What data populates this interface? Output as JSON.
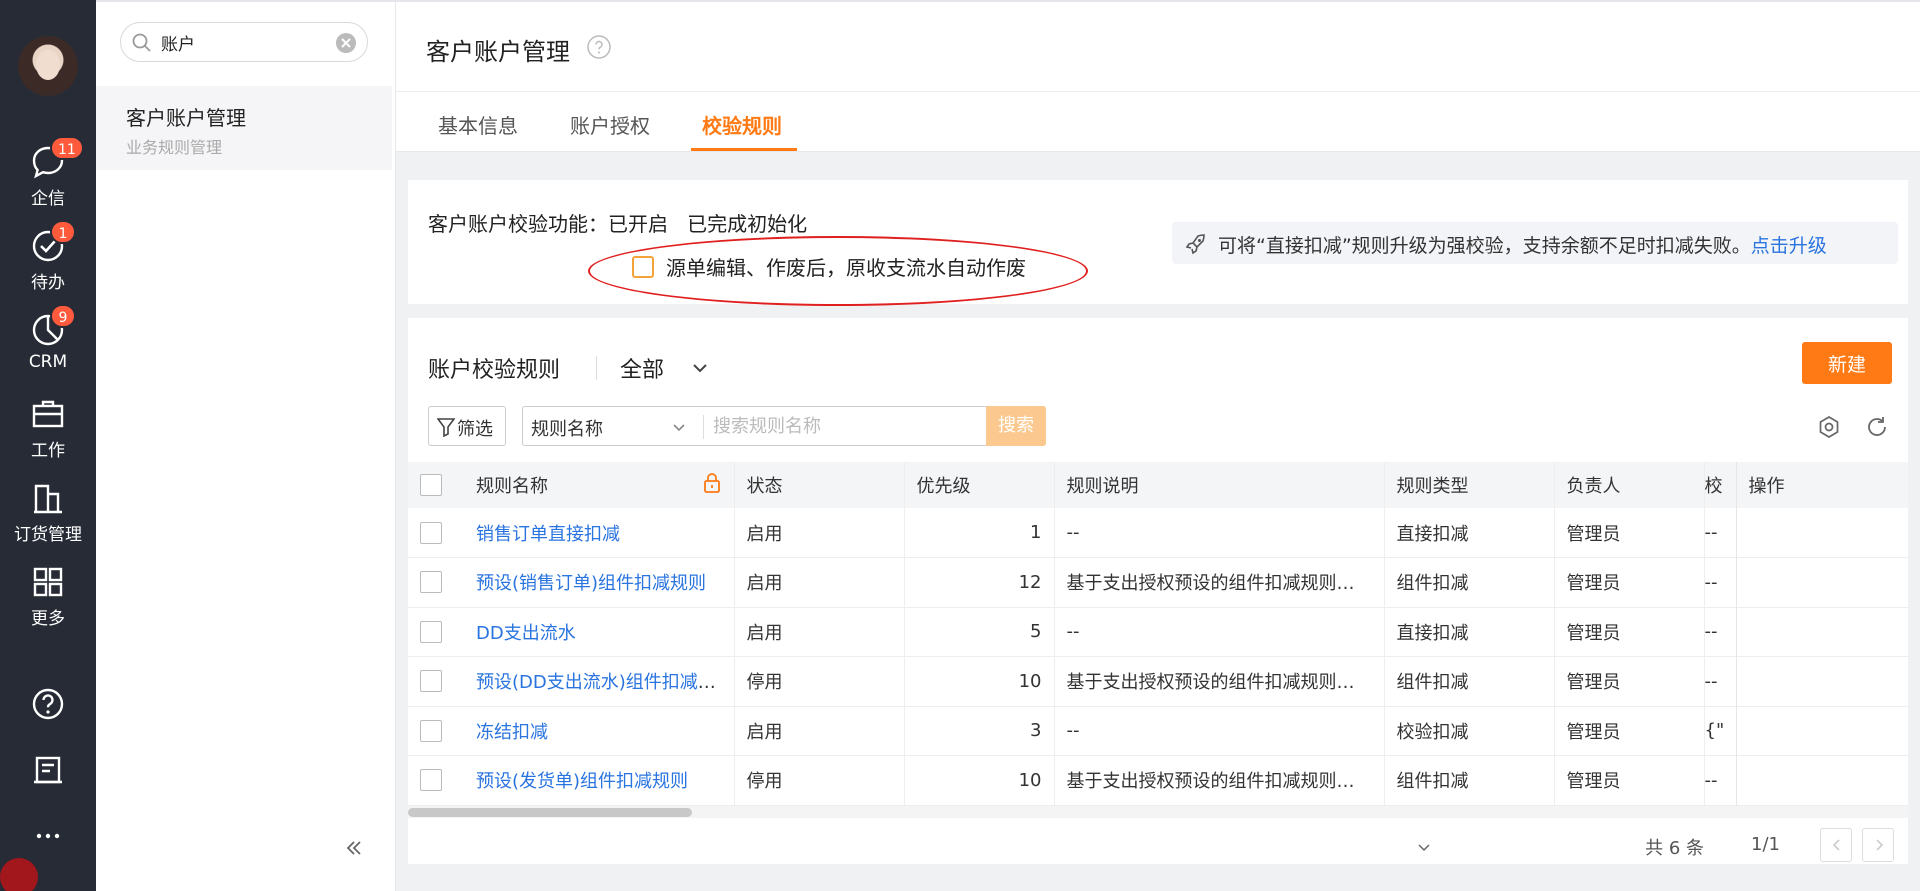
{
  "nav": {
    "items": [
      {
        "label": "企信",
        "badge": "11",
        "icon": "chat-bubble-icon"
      },
      {
        "label": "待办",
        "badge": "1",
        "icon": "check-circle-icon"
      },
      {
        "label": "CRM",
        "badge": "9",
        "icon": "pie-chart-icon"
      },
      {
        "label": "工作",
        "badge": "",
        "icon": "briefcase-icon"
      },
      {
        "label": "订货管理",
        "badge": "",
        "icon": "building-icon"
      },
      {
        "label": "更多",
        "badge": "",
        "icon": "grid-icon"
      }
    ],
    "bottom_icons": [
      "help-circle-icon",
      "notebook-icon",
      "more-dots-icon"
    ]
  },
  "sidebar": {
    "search_value": "账户",
    "item_title": "客户账户管理",
    "item_subtitle": "业务规则管理"
  },
  "header": {
    "title": "客户账户管理"
  },
  "tabs": [
    {
      "label": "基本信息",
      "active": false
    },
    {
      "label": "账户授权",
      "active": false
    },
    {
      "label": "校验规则",
      "active": true
    }
  ],
  "status": {
    "text": "客户账户校验功能：已开启   已完成初始化",
    "checkbox_label": "源单编辑、作废后，原收支流水自动作废",
    "tip_text": "可将“直接扣减”规则升级为强校验，支持余额不足时扣减失败。",
    "tip_link": "点击升级"
  },
  "rules": {
    "title": "账户校验规则",
    "scope": "全部",
    "new_button": "新建",
    "filter_button": "筛选",
    "field_select": "规则名称",
    "search_placeholder": "搜索规则名称",
    "search_button": "搜索",
    "columns": [
      "规则名称",
      "状态",
      "优先级",
      "规则说明",
      "规则类型",
      "负责人",
      "校",
      "操作"
    ],
    "rows": [
      {
        "name": "销售订单直接扣减",
        "status": "启用",
        "priority": "1",
        "desc": "--",
        "type": "直接扣减",
        "owner": "管理员",
        "extra": "--"
      },
      {
        "name": "预设(销售订单)组件扣减规则",
        "status": "启用",
        "priority": "12",
        "desc": "基于支出授权预设的组件扣减规则…",
        "type": "组件扣减",
        "owner": "管理员",
        "extra": "--"
      },
      {
        "name": "DD支出流水",
        "status": "启用",
        "priority": "5",
        "desc": "--",
        "type": "直接扣减",
        "owner": "管理员",
        "extra": "--"
      },
      {
        "name": "预设(DD支出流水)组件扣减规则",
        "status": "停用",
        "priority": "10",
        "desc": "基于支出授权预设的组件扣减规则…",
        "type": "组件扣减",
        "owner": "管理员",
        "extra": "--"
      },
      {
        "name": "冻结扣减",
        "status": "启用",
        "priority": "3",
        "desc": "--",
        "type": "校验扣减",
        "owner": "管理员",
        "extra": "{\""
      },
      {
        "name": "预设(发货单)组件扣减规则",
        "status": "停用",
        "priority": "10",
        "desc": "基于支出授权预设的组件扣减规则…",
        "type": "组件扣减",
        "owner": "管理员",
        "extra": "--"
      }
    ],
    "total": "共 6 条",
    "page": "1/1"
  },
  "colors": {
    "accent": "#ff7a14",
    "link": "#2a74e0",
    "nav_bg": "#262b36",
    "badge": "#ff5a3c"
  }
}
